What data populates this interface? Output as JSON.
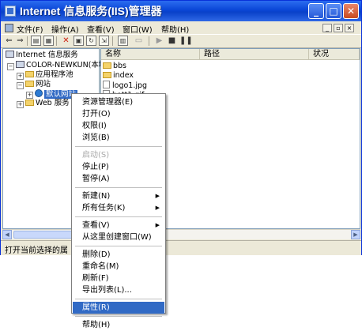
{
  "window": {
    "title": "Internet 信息服务(IIS)管理器",
    "controls": {
      "minimize": "_",
      "maximize": "□",
      "close": "✕"
    }
  },
  "menubar": {
    "items": [
      "文件(F)",
      "操作(A)",
      "查看(V)",
      "窗口(W)",
      "帮助(H)"
    ],
    "mdi_controls": [
      "_",
      "▫",
      "×"
    ]
  },
  "toolbar": {
    "icons": [
      "back-arrow-icon",
      "forward-arrow-icon",
      "up-folder-icon",
      "show-tree-icon",
      "delete-icon",
      "properties-icon",
      "refresh-icon",
      "export-list-icon",
      "properties-sheet-icon",
      "help-icon",
      "play-icon",
      "stop-icon",
      "pause-icon"
    ]
  },
  "tree": {
    "root": "Internet 信息服务",
    "server": "COLOR-NEWKUN(本地",
    "app_pools": "应用程序池",
    "websites": "网站",
    "default_site": "默认网站",
    "web_service": "Web 服务"
  },
  "list": {
    "columns": [
      "名称",
      "路径",
      "状况"
    ],
    "items": [
      {
        "name": "bbs",
        "type": "folder"
      },
      {
        "name": "index",
        "type": "folder"
      },
      {
        "name": "logo1.jpg",
        "type": "file"
      },
      {
        "name": "bott1.gif",
        "type": "file"
      }
    ]
  },
  "statusbar": {
    "text": "打开当前选择的属"
  },
  "context_menu": {
    "items": [
      {
        "label": "资源管理器(E)",
        "disabled": false,
        "submenu": false,
        "highlighted": false
      },
      {
        "label": "打开(O)",
        "disabled": false,
        "submenu": false,
        "highlighted": false
      },
      {
        "label": "权限(I)",
        "disabled": false,
        "submenu": false,
        "highlighted": false
      },
      {
        "label": "浏览(B)",
        "disabled": false,
        "submenu": false,
        "highlighted": false
      },
      {
        "separator": true
      },
      {
        "label": "启动(S)",
        "disabled": true,
        "submenu": false,
        "highlighted": false
      },
      {
        "label": "停止(P)",
        "disabled": false,
        "submenu": false,
        "highlighted": false
      },
      {
        "label": "暂停(A)",
        "disabled": false,
        "submenu": false,
        "highlighted": false
      },
      {
        "separator": true
      },
      {
        "label": "新建(N)",
        "disabled": false,
        "submenu": true,
        "highlighted": false
      },
      {
        "label": "所有任务(K)",
        "disabled": false,
        "submenu": true,
        "highlighted": false
      },
      {
        "separator": true
      },
      {
        "label": "查看(V)",
        "disabled": false,
        "submenu": true,
        "highlighted": false
      },
      {
        "label": "从这里创建窗口(W)",
        "disabled": false,
        "submenu": false,
        "highlighted": false
      },
      {
        "separator": true
      },
      {
        "label": "删除(D)",
        "disabled": false,
        "submenu": false,
        "highlighted": false
      },
      {
        "label": "重命名(M)",
        "disabled": false,
        "submenu": false,
        "highlighted": false
      },
      {
        "label": "刷新(F)",
        "disabled": false,
        "submenu": false,
        "highlighted": false
      },
      {
        "label": "导出列表(L)...",
        "disabled": false,
        "submenu": false,
        "highlighted": false
      },
      {
        "separator": true
      },
      {
        "label": "属性(R)",
        "disabled": false,
        "submenu": false,
        "highlighted": true
      },
      {
        "separator": true
      },
      {
        "label": "帮助(H)",
        "disabled": false,
        "submenu": false,
        "highlighted": false
      }
    ]
  },
  "colors": {
    "titlebar": "#0a46d6",
    "selection": "#316ac5",
    "chrome": "#ece9d8"
  }
}
